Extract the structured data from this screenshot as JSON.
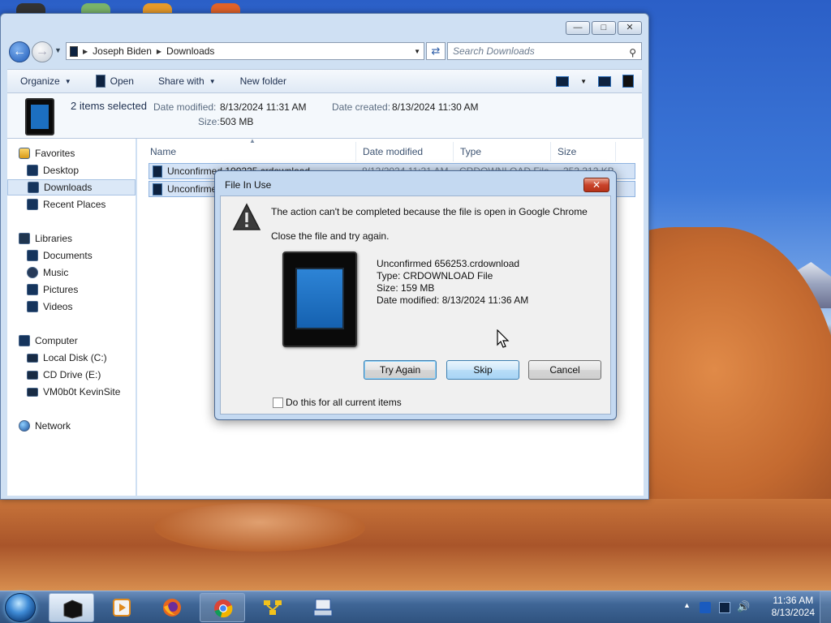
{
  "explorer": {
    "breadcrumb": [
      "Joseph Biden",
      "Downloads"
    ],
    "search_placeholder": "Search Downloads",
    "toolbar": {
      "organize": "Organize",
      "open": "Open",
      "share_with": "Share with",
      "new_folder": "New folder"
    },
    "details": {
      "selection": "2 items selected",
      "date_modified_label": "Date modified:",
      "date_modified": "8/13/2024 11:31 AM",
      "date_created_label": "Date created:",
      "date_created": "8/13/2024 11:30 AM",
      "size_label": "Size:",
      "size": "503 MB"
    },
    "nav": {
      "favorites": "Favorites",
      "desktop": "Desktop",
      "downloads": "Downloads",
      "recent_places": "Recent Places",
      "libraries": "Libraries",
      "documents": "Documents",
      "music": "Music",
      "pictures": "Pictures",
      "videos": "Videos",
      "computer": "Computer",
      "local_disk": "Local Disk (C:)",
      "cd_drive": "CD Drive (E:)",
      "kevin_site": "VM0b0t KevinSite",
      "network": "Network"
    },
    "columns": {
      "name": "Name",
      "date_modified": "Date modified",
      "type": "Type",
      "size": "Size"
    },
    "files": [
      {
        "name": "Unconfirmed 100225.crdownload",
        "date": "8/13/2024 11:31 AM",
        "type": "CRDOWNLOAD File",
        "size": "353,312 KB"
      },
      {
        "name": "Unconfirmed 656253.crdownload",
        "date": "",
        "type": "",
        "size": ""
      }
    ]
  },
  "dialog": {
    "title": "File In Use",
    "message": "The action can't be completed because the file is open in Google Chrome",
    "instruction": "Close the file and try again.",
    "file": {
      "name": "Unconfirmed 656253.crdownload",
      "type": "Type: CRDOWNLOAD File",
      "size": "Size: 159 MB",
      "date": "Date modified: 8/13/2024 11:36 AM"
    },
    "buttons": {
      "try_again": "Try Again",
      "skip": "Skip",
      "cancel": "Cancel"
    },
    "checkbox_label": "Do this for all current items",
    "checkbox_checked": false
  },
  "taskbar": {
    "apps": [
      "explorer-icon",
      "media-player-icon",
      "firefox-icon",
      "chrome-icon",
      "network-share-icon",
      "keyboard-app-icon"
    ],
    "clock": {
      "time": "11:36 AM",
      "date": "8/13/2024"
    }
  },
  "colors": {
    "accent": "#3c7fb1",
    "close_red": "#c9432a",
    "selection": "#d4e3f6"
  }
}
